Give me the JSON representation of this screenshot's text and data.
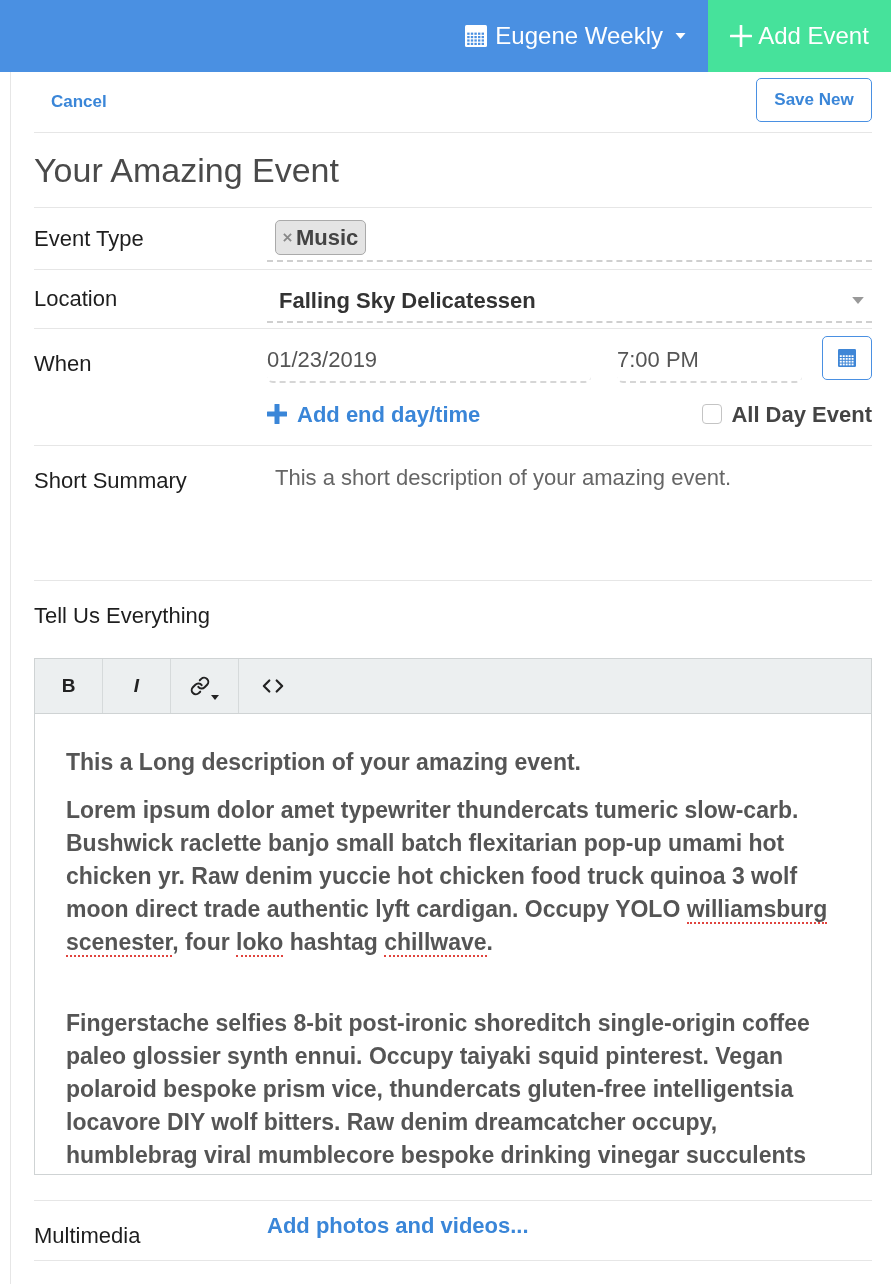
{
  "top_bar": {
    "calendar_menu": "Eugene Weekly",
    "add_button": "Add Event"
  },
  "actions": {
    "cancel": "Cancel",
    "save": "Save New"
  },
  "title": "Your Amazing Event",
  "fields": [
    {
      "kind": "tags",
      "label": "Event Type",
      "tags": [
        "Music"
      ]
    },
    {
      "kind": "select",
      "label": "Location",
      "value": "Falling Sky Delicatessen"
    },
    {
      "kind": "datetime",
      "label": "When",
      "date": "01/23/2019",
      "time": "7:00 PM",
      "add_end": "Add end day/time",
      "all_day": {
        "label": "All Day Event",
        "checked": false
      }
    },
    {
      "kind": "textarea",
      "label": "Short Summary",
      "value": "This a short description of your amazing event."
    },
    {
      "kind": "editor",
      "label": "Tell Us Everything",
      "toolbar": [
        {
          "kind": "bold",
          "label": "B"
        },
        {
          "kind": "italic",
          "label": "I"
        },
        {
          "kind": "link"
        },
        {
          "kind": "code"
        }
      ],
      "paragraphs": [
        {
          "segments": [
            {
              "text": "This a Long description of your amazing event.",
              "misspelled": false
            }
          ]
        },
        {
          "segments": [
            {
              "text": "Lorem ipsum dolor amet typewriter thundercats tumeric slow-carb. Bushwick raclette banjo small batch flexitarian pop-up umami hot chicken yr. Raw denim yuccie hot chicken food truck quinoa 3 wolf moon direct trade authentic lyft cardigan. Occupy YOLO ",
              "misspelled": false
            },
            {
              "text": "williamsburg scenester",
              "misspelled": true
            },
            {
              "text": ", four ",
              "misspelled": false
            },
            {
              "text": "loko",
              "misspelled": true
            },
            {
              "text": " hashtag ",
              "misspelled": false
            },
            {
              "text": "chillwave",
              "misspelled": true
            },
            {
              "text": ".",
              "misspelled": false
            }
          ]
        },
        {
          "segments": [
            {
              "text": "Fingerstache selfies 8-bit post-ironic shoreditch single-origin coffee paleo glossier synth ennui. Occupy taiyaki squid pinterest. Vegan polaroid bespoke prism vice, thundercats gluten-free intelligentsia locavore DIY wolf bitters. Raw denim dreamcatcher occupy, humblebrag viral mumblecore bespoke drinking vinegar succulents",
              "misspelled": false
            }
          ]
        }
      ]
    },
    {
      "kind": "media",
      "label": "Multimedia",
      "action": "Add photos and videos..."
    }
  ]
}
